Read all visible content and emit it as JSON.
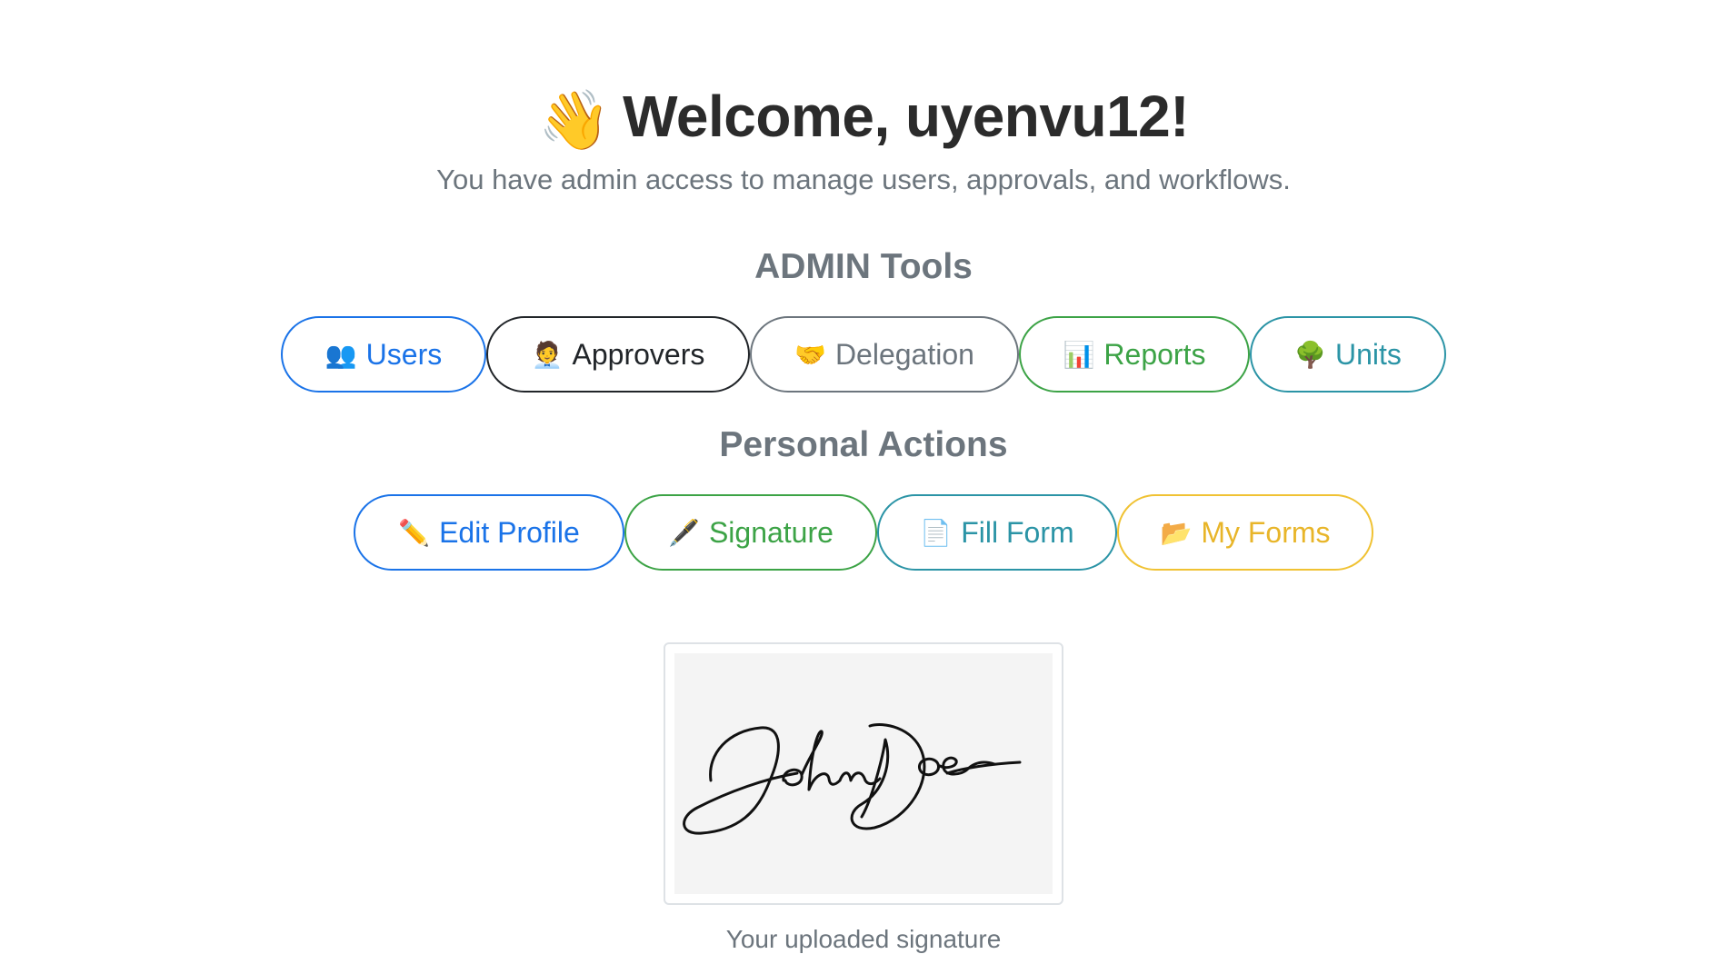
{
  "header": {
    "wave_emoji": "👋",
    "greeting": "Welcome, uyenvu12!",
    "subtitle": "You have admin access to manage users, approvals, and workflows."
  },
  "admin_tools": {
    "title": "ADMIN Tools",
    "buttons": [
      {
        "icon": "👥",
        "icon_name": "users-icon",
        "label": "Users",
        "color": "#1a73e8"
      },
      {
        "icon": "🧑‍💼",
        "icon_name": "approver-icon",
        "label": "Approvers",
        "color": "#212529"
      },
      {
        "icon": "🤝",
        "icon_name": "handshake-icon",
        "label": "Delegation",
        "color": "#6c757d"
      },
      {
        "icon": "📊",
        "icon_name": "bar-chart-icon",
        "label": "Reports",
        "color": "#3ca346"
      },
      {
        "icon": "🌳",
        "icon_name": "tree-icon",
        "label": "Units",
        "color": "#2b94a6"
      }
    ]
  },
  "personal_actions": {
    "title": "Personal Actions",
    "buttons": [
      {
        "icon": "✏️",
        "icon_name": "pencil-icon",
        "label": "Edit Profile",
        "color": "#1a73e8"
      },
      {
        "icon": "🖋️",
        "icon_name": "pen-icon",
        "label": "Signature",
        "color": "#3ca346"
      },
      {
        "icon": "📄",
        "icon_name": "document-icon",
        "label": "Fill Form",
        "color": "#2b94a6"
      },
      {
        "icon": "📂",
        "icon_name": "folder-icon",
        "label": "My Forms",
        "color": "#e8b529"
      }
    ]
  },
  "signature": {
    "image_text": "John Doe",
    "caption": "Your uploaded signature"
  }
}
